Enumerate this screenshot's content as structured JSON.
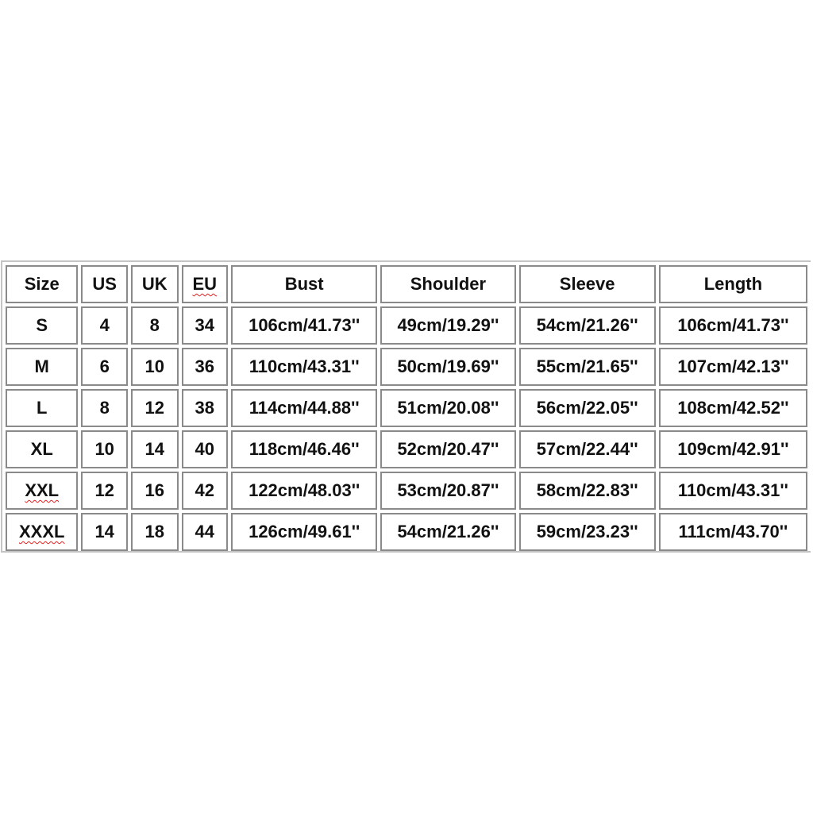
{
  "table": {
    "headers": [
      "Size",
      "US",
      "UK",
      "EU",
      "Bust",
      "Shoulder",
      "Sleeve",
      "Length"
    ],
    "rows": [
      [
        "S",
        "4",
        "8",
        "34",
        "106cm/41.73''",
        "49cm/19.29''",
        "54cm/21.26''",
        "106cm/41.73''"
      ],
      [
        "M",
        "6",
        "10",
        "36",
        "110cm/43.31''",
        "50cm/19.69''",
        "55cm/21.65''",
        "107cm/42.13''"
      ],
      [
        "L",
        "8",
        "12",
        "38",
        "114cm/44.88''",
        "51cm/20.08''",
        "56cm/22.05''",
        "108cm/42.52''"
      ],
      [
        "XL",
        "10",
        "14",
        "40",
        "118cm/46.46''",
        "52cm/20.47''",
        "57cm/22.44''",
        "109cm/42.91''"
      ],
      [
        "XXL",
        "12",
        "16",
        "42",
        "122cm/48.03''",
        "53cm/20.87''",
        "58cm/22.83''",
        "110cm/43.31''"
      ],
      [
        "XXXL",
        "14",
        "18",
        "44",
        "126cm/49.61''",
        "54cm/21.26''",
        "59cm/23.23''",
        "111cm/43.70''"
      ]
    ]
  },
  "spellcheck_flagged": [
    "EU",
    "XXL",
    "XXXL"
  ],
  "colors": {
    "cell_border": "#8a8a8a",
    "outer_border": "#c4c4c4",
    "spellcheck": "#e02020"
  }
}
